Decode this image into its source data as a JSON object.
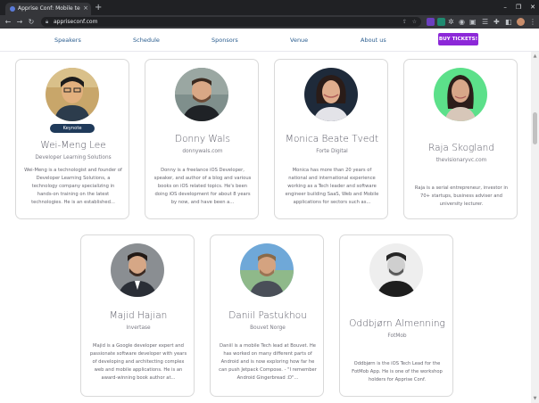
{
  "browser": {
    "tab_title": "Apprise Conf: Mobile tech conf...",
    "tab_close": "×",
    "new_tab": "+",
    "url": "appriseconf.com",
    "window_controls": [
      "–",
      "❐",
      "✕"
    ]
  },
  "nav": {
    "links": [
      "Speakers",
      "Schedule",
      "Sponsors",
      "Venue",
      "About us"
    ],
    "cta": "BUY TICKETS!",
    "cta_color": "#8c28d8"
  },
  "speakers": [
    {
      "name": "Wei-Meng Lee",
      "company": "Developer Learning Solutions",
      "badge": "Keynote",
      "bio": "Wei-Meng is a technologist and founder of Developer Learning Solutions, a technology company specializing in hands-on training on the latest technologies. He is an established..."
    },
    {
      "name": "Donny Wals",
      "company": "donnywals.com",
      "bio": "Donny is a freelance iOS Developer, speaker, and author of a blog and various books on iOS related topics. He's been doing iOS development for about 8 years by now, and have been a..."
    },
    {
      "name": "Monica Beate Tvedt",
      "company": "Forte Digital",
      "bio": "Monica has more than 20 years of national and international experience working as a Tech leader and software engineer building SaaS, Web and Mobile applications for sectors such as..."
    },
    {
      "name": "Raja Skogland",
      "company": "thevisionaryvc.com",
      "bio": "Raja is a serial entrepreneur, investor in 70+ startups, business adviser and university lecturer."
    },
    {
      "name": "Majid Hajian",
      "company": "Invertase",
      "bio": "Majid is a Google developer expert and passionate software developer with years of developing and architecting complex web and mobile applications. He is an award-winning book author at..."
    },
    {
      "name": "Daniil Pastukhou",
      "company": "Bouvet Norge",
      "bio": "Daniil is a mobile Tech lead at Bouvet. He has worked on many different parts of Android and is now exploring how far he can push Jetpack Compose. - \"I remember Android Gingerbread :D\"..."
    },
    {
      "name": "Oddbjørn Almenning",
      "company": "FotMob",
      "bio": "Oddbjørn is the iOS Tech Lead for the FotMob App. He is one of the workshop holders for Apprise Conf."
    }
  ],
  "icons": {
    "back": "back-arrow-icon",
    "forward": "forward-arrow-icon",
    "reload": "reload-icon",
    "lock": "lock-icon",
    "share": "share-icon",
    "star": "star-icon",
    "extensions": "puzzle-icon",
    "menu": "kebab-menu-icon"
  }
}
